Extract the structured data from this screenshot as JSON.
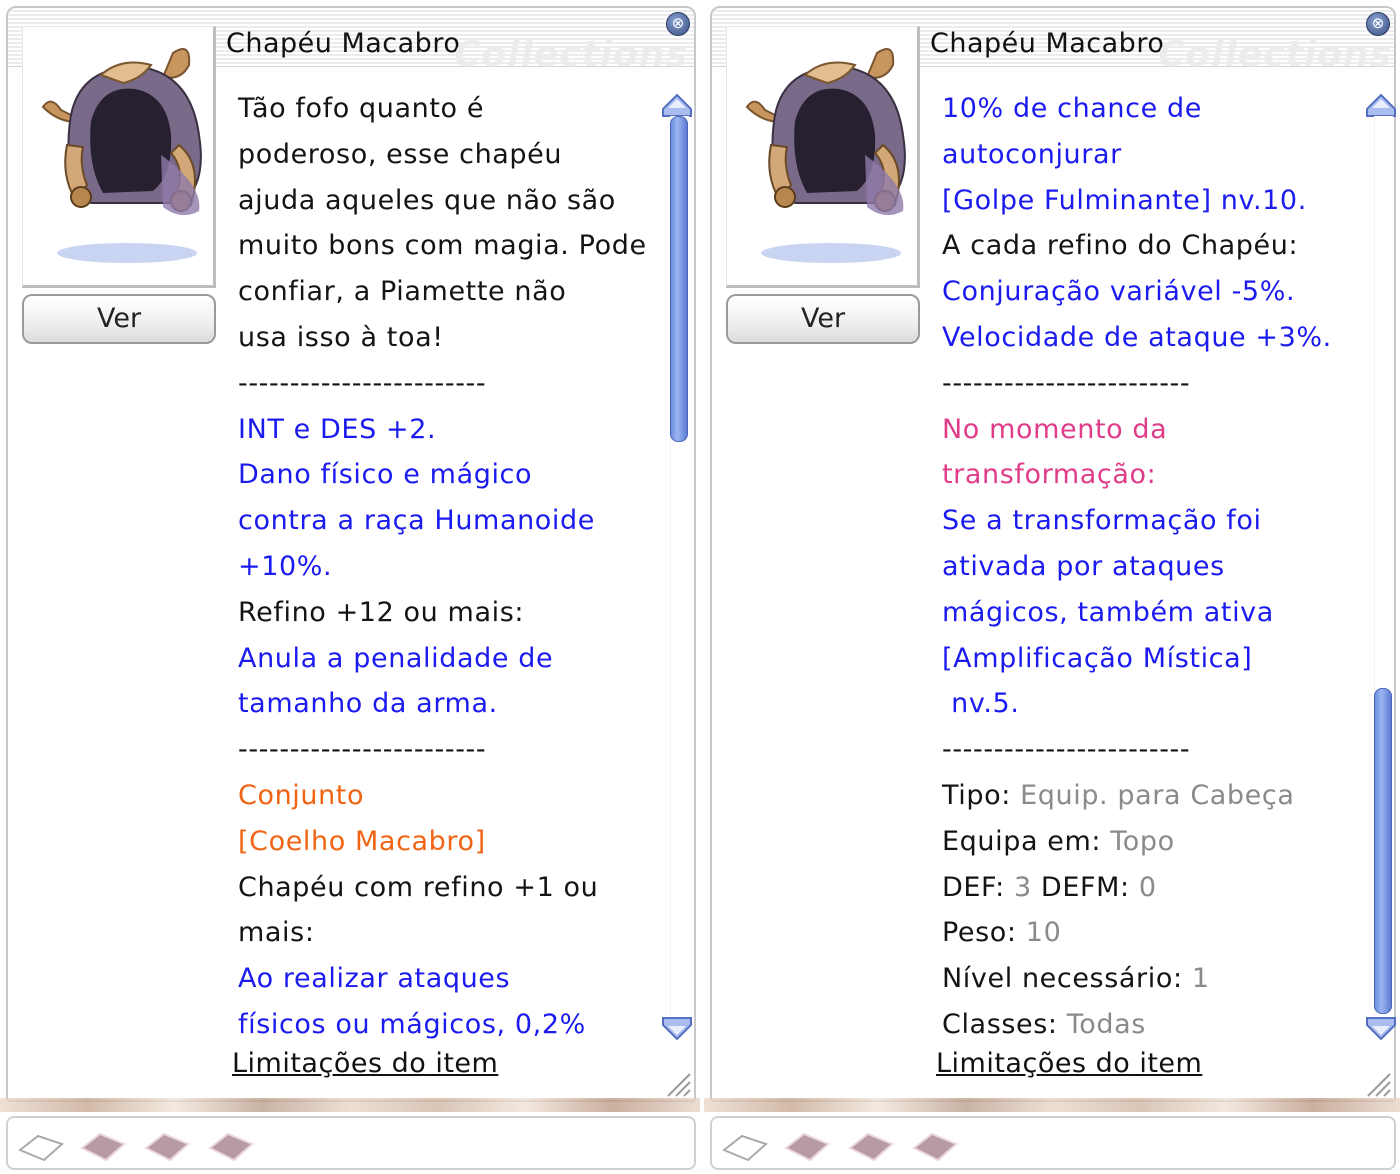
{
  "panels": [
    {
      "title": "Chapéu Macabro",
      "watermark": "Collections",
      "close_glyph": "⊗",
      "view_button": "Ver",
      "description_lines": [
        {
          "text": "Tão fofo quanto é",
          "color": "black"
        },
        {
          "text": "poderoso, esse chapéu",
          "color": "black"
        },
        {
          "text": "ajuda aqueles que não são",
          "color": "black"
        },
        {
          "text": "muito bons com magia. Pode",
          "color": "black"
        },
        {
          "text": "confiar, a Piamette não",
          "color": "black"
        },
        {
          "text": "usa isso à toa!",
          "color": "black"
        },
        {
          "text": "------------------------",
          "color": "black"
        },
        {
          "text": "INT e DES +2.",
          "color": "blue"
        },
        {
          "text": "Dano físico e mágico",
          "color": "blue"
        },
        {
          "text": "contra a raça Humanoide",
          "color": "blue"
        },
        {
          "text": "+10%.",
          "color": "blue"
        },
        {
          "text": "Refino +12 ou mais:",
          "color": "black"
        },
        {
          "text": "Anula a penalidade de",
          "color": "blue"
        },
        {
          "text": "tamanho da arma.",
          "color": "blue"
        },
        {
          "text": "------------------------",
          "color": "black"
        },
        {
          "text": "Conjunto",
          "color": "orange"
        },
        {
          "text": "[Coelho Macabro]",
          "color": "orange"
        },
        {
          "text": "Chapéu com refino +1 ou",
          "color": "black"
        },
        {
          "text": "mais:",
          "color": "black"
        },
        {
          "text": "Ao realizar ataques",
          "color": "blue"
        },
        {
          "text": "físicos ou mágicos, 0,2%",
          "color": "blue"
        }
      ],
      "limitations_link": "Limitações do item",
      "scroll_position": 0.0
    },
    {
      "title": "Chapéu Macabro",
      "watermark": "Collections",
      "close_glyph": "⊗",
      "view_button": "Ver",
      "description_lines": [
        {
          "text": "10% de chance de",
          "color": "blue"
        },
        {
          "text": "autoconjurar",
          "color": "blue"
        },
        {
          "text": "[Golpe Fulminante] nv.10.",
          "color": "blue"
        },
        {
          "text": "A cada refino do Chapéu:",
          "color": "black"
        },
        {
          "text": "Conjuração variável -5%.",
          "color": "blue"
        },
        {
          "text": "Velocidade de ataque +3%.",
          "color": "blue"
        },
        {
          "text": "------------------------",
          "color": "black"
        },
        {
          "text": "No momento da",
          "color": "pink"
        },
        {
          "text": "transformação:",
          "color": "pink"
        },
        {
          "text": "Se a transformação foi",
          "color": "blue"
        },
        {
          "text": "ativada por ataques",
          "color": "blue"
        },
        {
          "text": "mágicos, também ativa",
          "color": "blue"
        },
        {
          "text": "[Amplificação Mística]",
          "color": "blue"
        },
        {
          "text": " nv.5.",
          "color": "blue"
        },
        {
          "text": "------------------------",
          "color": "black"
        }
      ],
      "properties": [
        {
          "label": "Tipo:",
          "value": " Equip. para Cabeça"
        },
        {
          "label": "Equipa em:",
          "value": " Topo"
        },
        {
          "label": "DEF:",
          "value": " 3",
          "label2": " DEFM:",
          "value2": " 0"
        },
        {
          "label": "Peso:",
          "value": " 10"
        },
        {
          "label": "Nível necessário:",
          "value": " 1"
        },
        {
          "label": "Classes:",
          "value": " Todas"
        }
      ],
      "limitations_link": "Limitações do item",
      "scroll_position": 1.0
    }
  ],
  "bottom_slots": [
    "empty-slot-icon",
    "card-slot-icon",
    "card-slot-icon",
    "card-slot-icon"
  ],
  "colors": {
    "black": "#141414",
    "blue": "#1b1bf0",
    "orange": "#f06414",
    "pink": "#e03c8a",
    "gray": "#8a8a8a",
    "scroll_thumb": "#6e8fe0"
  }
}
